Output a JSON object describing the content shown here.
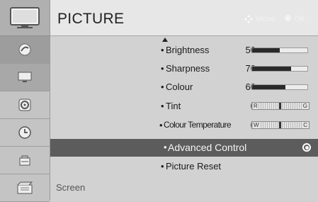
{
  "header": {
    "title": "PICTURE",
    "hint_move": "Move",
    "hint_ok": "OK"
  },
  "sidebar": {
    "items": [
      {
        "icon": "picture-icon"
      },
      {
        "icon": "satellite-icon"
      },
      {
        "icon": "monitor-icon"
      },
      {
        "icon": "speaker-icon"
      },
      {
        "icon": "clock-icon"
      },
      {
        "icon": "lock-icon"
      },
      {
        "icon": "options-icon"
      }
    ]
  },
  "menu": {
    "brightness": {
      "label": "Brightness",
      "value": "50",
      "level": 0.5
    },
    "sharpness": {
      "label": "Sharpness",
      "value": "70",
      "level": 0.7
    },
    "colour": {
      "label": "Colour",
      "value": "60",
      "level": 0.6
    },
    "tint": {
      "label": "Tint",
      "value": "0",
      "left": "R",
      "right": "G"
    },
    "colour_temperature": {
      "label": "Colour Temperature",
      "value": "0",
      "left": "W",
      "right": "C"
    },
    "advanced_control": {
      "label": "Advanced Control"
    },
    "picture_reset": {
      "label": "Picture Reset"
    }
  },
  "footer": {
    "label": "Screen"
  },
  "colors": {
    "selected_bg": "#5c5c5c",
    "bar_fill": "#2a2a2a"
  }
}
